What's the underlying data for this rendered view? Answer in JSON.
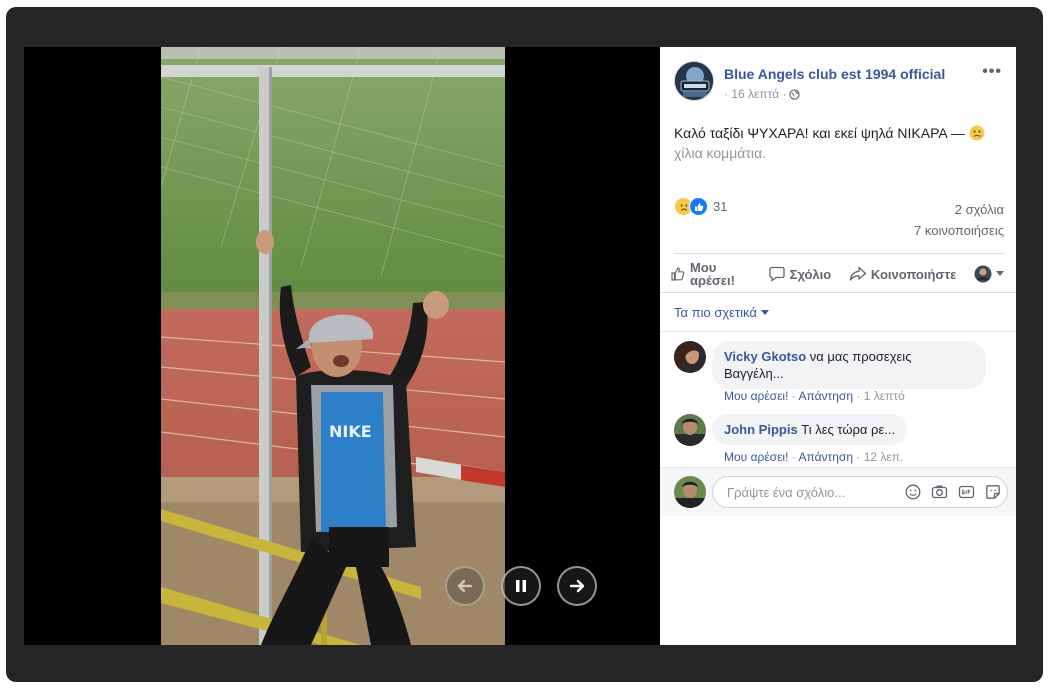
{
  "post": {
    "page_name": "Blue Angels club est 1994 official",
    "time": "· 16 λεπτά ·",
    "privacy_icon": "globe-icon",
    "more_label": "•••",
    "text_main": "Καλό ταξίδι ΨΥΧΑΡΑ! και εκεί ψηλά ΝΙΚΑΡΑ — ",
    "text_muted": "χίλια κομμάτια."
  },
  "stats": {
    "reaction_count": "31",
    "comments": "2 σχόλια",
    "shares": "7 κοινοποιήσεις"
  },
  "actions": {
    "like": "Μου αρέσει!",
    "comment": "Σχόλιο",
    "share": "Κοινοποιήστε"
  },
  "sort_label": "Τα πιο σχετικά",
  "comments": [
    {
      "author": "Vicky Gkotso",
      "text": "να μας προσεχεις Βαγγέλη...",
      "like": "Μου αρέσει!",
      "reply": "Απάντηση",
      "time": "1 λεπτό"
    },
    {
      "author": "John Pippis",
      "text": "Τι λες τώρα ρε...",
      "like": "Μου αρέσει!",
      "reply": "Απάντηση",
      "time": "12 λεπ."
    }
  ],
  "reply": {
    "placeholder": "Γράψτε ένα σχόλιο..."
  },
  "colors": {
    "link": "#385898",
    "backdrop": "#252525",
    "like_blue": "#1877f2"
  }
}
